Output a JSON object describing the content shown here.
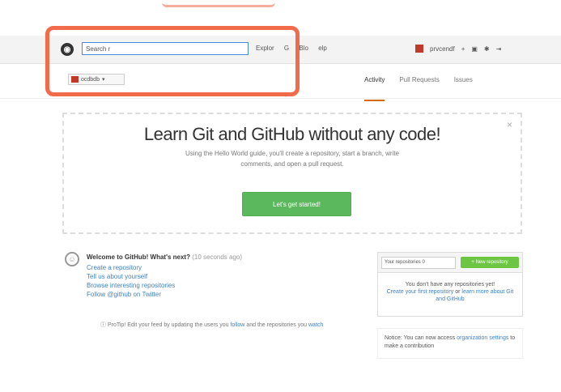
{
  "header": {
    "search_value": "Search r",
    "nav": [
      "Explor",
      "G",
      "Blo",
      "elp"
    ],
    "user_name": "prvcendf",
    "icon_labels": [
      "+",
      "notifications",
      "settings",
      "sign-out"
    ]
  },
  "org_switcher": {
    "label": "ocdbdb"
  },
  "tabs": [
    "Activity",
    "Pull Requests",
    "Issues"
  ],
  "banner": {
    "title": "Learn Git and GitHub without any code!",
    "text": "Using the Hello World guide, you'll create a repository, start a branch, write comments, and open a pull request.",
    "button": "Let's get started!",
    "close": "×"
  },
  "feed": {
    "title_bold": "Welcome to GitHub! What's next?",
    "title_muted": "(10 seconds ago)",
    "links": [
      "Create a repository",
      "Tell us about yourself",
      "Browse interesting repositories",
      "Follow @github on Twitter"
    ],
    "tip_prefix": "ProTip! Edit your feed by updating the users you",
    "tip_link": "follow",
    "tip_middle": "and the repositories you",
    "tip_link2": "watch"
  },
  "repo_panel": {
    "filter_label": "Your repositories  0",
    "new_button": "+ New repository",
    "empty_text": "You don't have any repositories yet!",
    "create_link": "Create your first repository",
    "learn_text": "or",
    "learn_link": "learn more about Git and GitHub"
  },
  "notice": {
    "text": "Notice: You can now access",
    "link": "organization settings",
    "rest": "to make a contribution"
  },
  "colors": {
    "highlight": "#f26b4b",
    "primary_button": "#5cb85c",
    "link": "#4183c4",
    "active_tab": "#d26911"
  }
}
